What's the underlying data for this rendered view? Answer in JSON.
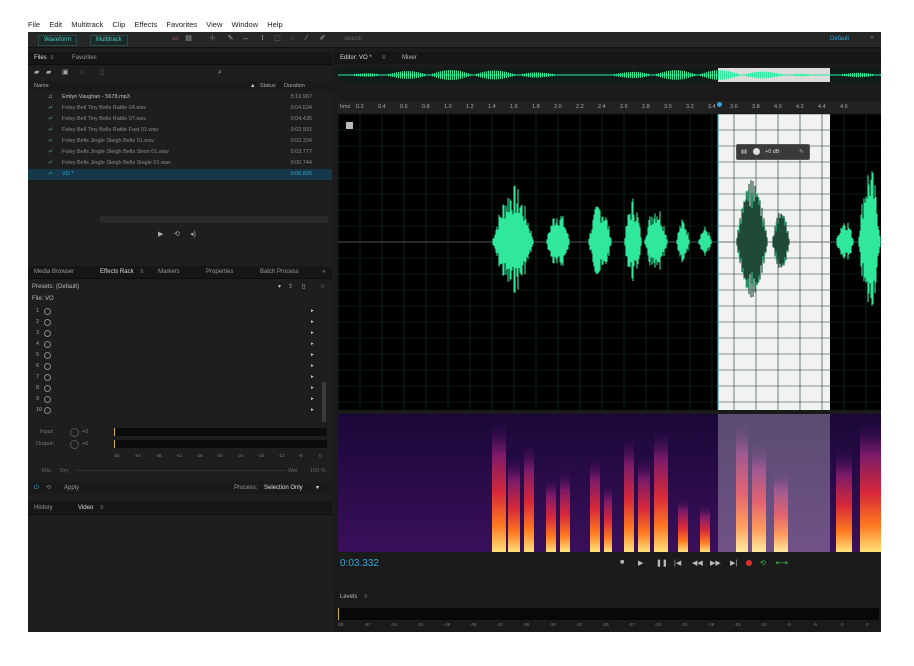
{
  "menu": [
    "File",
    "Edit",
    "Multitrack",
    "Clip",
    "Effects",
    "Favorites",
    "View",
    "Window",
    "Help"
  ],
  "toolbar": {
    "waveform_label": "Waveform",
    "multitrack_label": "Multitrack",
    "search_placeholder": "search",
    "workspace": "Default"
  },
  "files_panel": {
    "tabs": [
      "Files",
      "Favorites"
    ],
    "col_name": "Name",
    "col_status": "Status",
    "col_duration": "Duration",
    "rows": [
      {
        "name": "Emlyn Vaughan - 5678.mp3",
        "duration": "5:19.967",
        "active": false
      },
      {
        "name": "Foley Bell Tiny Bells Rattle 04.wav",
        "duration": "0:04.634",
        "active": false
      },
      {
        "name": "Foley Bell Tiny Bells Rattle 07.wav",
        "duration": "0:04.435",
        "active": false
      },
      {
        "name": "Foley Bell Tiny Bells Rattle Fast 01.wav",
        "duration": "0:02.931",
        "active": false
      },
      {
        "name": "Foley Bells Jingle Sleigh Bells 01.wav",
        "duration": "0:02.334",
        "active": false
      },
      {
        "name": "Foley Bells Jingle Sleigh Bells Short 01.wav",
        "duration": "0:03.777",
        "active": false
      },
      {
        "name": "Foley Bells Jingle Sleigh Bells Single 01.wav",
        "duration": "0:00.744",
        "active": false
      },
      {
        "name": "VO *",
        "duration": "0:06.826",
        "active": true
      }
    ]
  },
  "effects_panel": {
    "tabs": [
      "Media Browser",
      "Effects Rack",
      "Markers",
      "Properties",
      "Batch Process"
    ],
    "presets_label": "Presets:",
    "preset_value": "(Default)",
    "file_label": "File: VO",
    "slots": [
      "1",
      "2",
      "3",
      "4",
      "5",
      "6",
      "7",
      "8",
      "9",
      "10"
    ],
    "input_label": "Input:",
    "output_label": "Output:",
    "input_value": "+0",
    "output_value": "+0",
    "mix_label": "Mix:",
    "mix_dry": "Dry",
    "mix_wet": "Wet",
    "mix_percent": "100 %",
    "meter_ticks": [
      "dB",
      "-54",
      "-48",
      "-42",
      "-36",
      "-30",
      "-24",
      "-18",
      "-12",
      "-6",
      "0"
    ],
    "apply_label": "Apply",
    "process_label": "Process:",
    "process_value": "Selection Only"
  },
  "bottom_panel": {
    "tabs": [
      "History",
      "Video"
    ]
  },
  "editor": {
    "tabs": [
      "Editor: VO *",
      "Mixer"
    ],
    "ruler_unit": "hms",
    "ruler_ticks": [
      "0.2",
      "0.4",
      "0.6",
      "0.8",
      "1.0",
      "1.2",
      "1.4",
      "1.6",
      "1.8",
      "2.0",
      "2.2",
      "2.4",
      "2.6",
      "2.8",
      "3.0",
      "3.2",
      "3.4",
      "3.6",
      "3.8",
      "4.0",
      "4.2",
      "4.4",
      "4.6"
    ],
    "hud_volume": "+0 dB",
    "time_display": "0:03.332",
    "levels_label": "Levels",
    "levels_ticks": [
      "dB",
      "-57",
      "-54",
      "-51",
      "-48",
      "-45",
      "-42",
      "-39",
      "-36",
      "-33",
      "-30",
      "-27",
      "-24",
      "-21",
      "-18",
      "-15",
      "-12",
      "-9",
      "-6",
      "-3",
      "0"
    ]
  },
  "colors": {
    "waveform": "#2fe89b",
    "selection": "#f2f2f2",
    "accent": "#2fa8d8",
    "record": "#e03030"
  }
}
